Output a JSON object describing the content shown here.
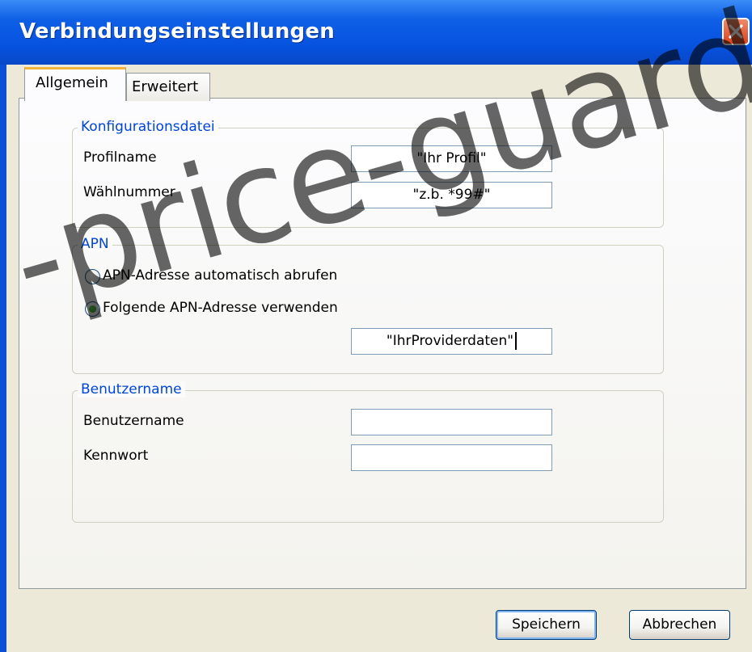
{
  "window": {
    "title": "Verbindungseinstellungen"
  },
  "tabs": [
    {
      "label": "Allgemein",
      "active": true
    },
    {
      "label": "Erweitert",
      "active": false
    }
  ],
  "config": {
    "legend": "Konfigurationsdatei",
    "profile_label": "Profilname",
    "profile_value": "\"Ihr Profil\"",
    "dial_label": "Wählnummer",
    "dial_value": "\"z.b. *99#\""
  },
  "apn": {
    "legend": "APN",
    "auto_label": "APN-Adresse automatisch abrufen",
    "manual_label": "Folgende APN-Adresse verwenden",
    "selected": "manual",
    "address_value": "\"IhrProviderdaten\""
  },
  "user": {
    "legend": "Benutzername",
    "username_label": "Benutzername",
    "username_value": "",
    "password_label": "Kennwort",
    "password_value": ""
  },
  "buttons": {
    "save": "Speichern",
    "cancel": "Abbrechen"
  },
  "watermark": "-price-guard",
  "colors": {
    "titlebar": "#0653e0",
    "legend_text": "#0046d5",
    "client_bg": "#ece9d8",
    "radio_selected": "#2aa52a"
  },
  "icons": {
    "close": "close-x-icon"
  }
}
